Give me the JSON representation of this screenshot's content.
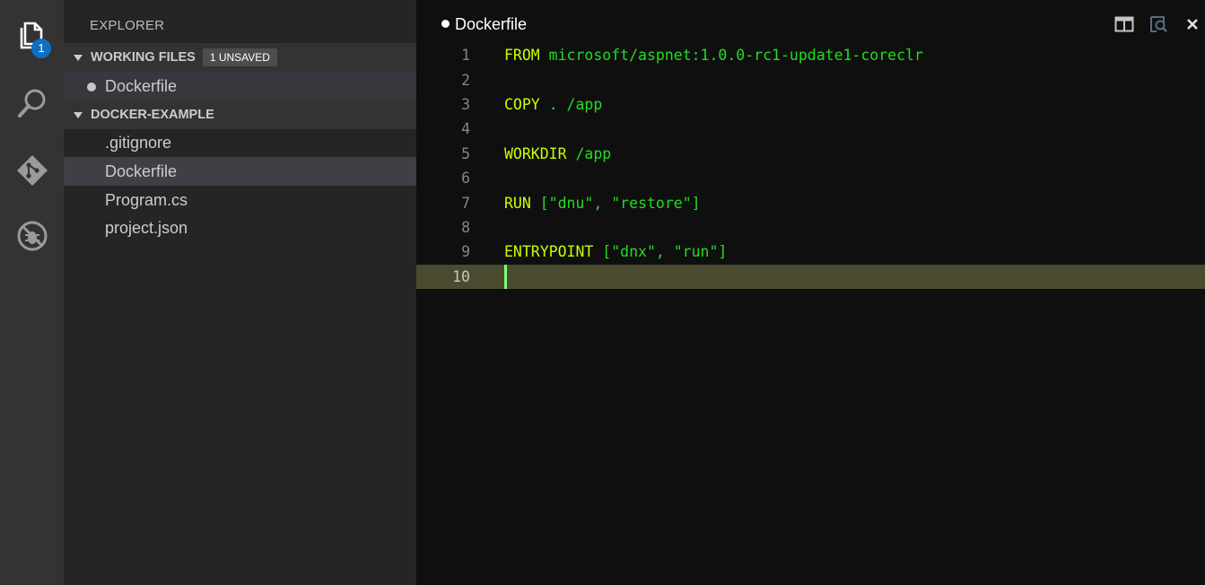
{
  "activity_bar": {
    "items": [
      {
        "name": "explorer",
        "icon": "files-icon",
        "badge": "1"
      },
      {
        "name": "search",
        "icon": "search-icon"
      },
      {
        "name": "git",
        "icon": "git-icon"
      },
      {
        "name": "debug",
        "icon": "debug-icon"
      }
    ]
  },
  "sidebar": {
    "title": "EXPLORER",
    "working_files": {
      "header": "WORKING FILES",
      "badge": "1 UNSAVED",
      "files": [
        {
          "name": "Dockerfile",
          "dirty": true
        }
      ]
    },
    "project": {
      "header": "DOCKER-EXAMPLE",
      "files": [
        {
          "name": ".gitignore"
        },
        {
          "name": "Dockerfile",
          "selected": true
        },
        {
          "name": "Program.cs"
        },
        {
          "name": "project.json"
        }
      ]
    }
  },
  "editor": {
    "tab_title": "Dockerfile",
    "dirty": true,
    "current_line": 10,
    "lines": [
      {
        "number": "1",
        "keyword": "FROM",
        "args": " microsoft/aspnet:1.0.0-rc1-update1-coreclr"
      },
      {
        "number": "2",
        "keyword": "",
        "args": ""
      },
      {
        "number": "3",
        "keyword": "COPY",
        "args": " . /app"
      },
      {
        "number": "4",
        "keyword": "",
        "args": ""
      },
      {
        "number": "5",
        "keyword": "WORKDIR",
        "args": " /app"
      },
      {
        "number": "6",
        "keyword": "",
        "args": ""
      },
      {
        "number": "7",
        "keyword": "RUN",
        "args": " [\"dnu\", \"restore\"]"
      },
      {
        "number": "8",
        "keyword": "",
        "args": ""
      },
      {
        "number": "9",
        "keyword": "ENTRYPOINT",
        "args": " [\"dnx\", \"run\"]"
      },
      {
        "number": "10",
        "keyword": "",
        "args": ""
      }
    ],
    "actions": [
      {
        "name": "split-editor-icon"
      },
      {
        "name": "open-preview-icon"
      },
      {
        "name": "close-icon"
      }
    ]
  },
  "colors": {
    "keyword": "#c8ff00",
    "argument": "#22dd22",
    "badge": "#0e70c0",
    "current_line": "#4a4a2e"
  }
}
